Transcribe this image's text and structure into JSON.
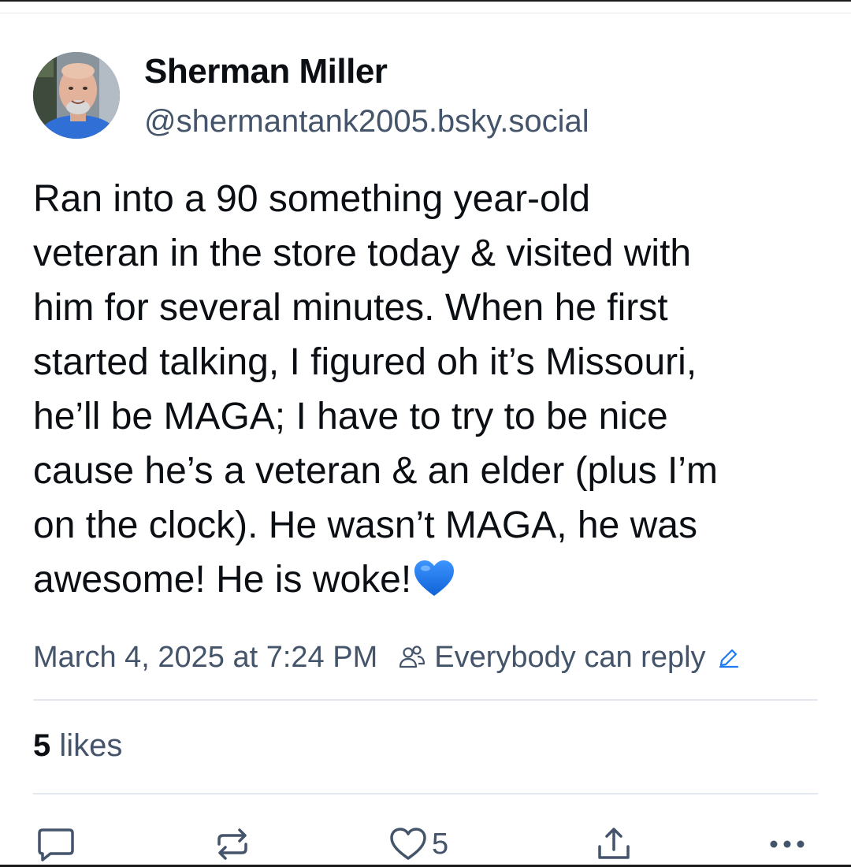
{
  "post": {
    "author": {
      "display_name": "Sherman Miller",
      "handle": "@shermantank2005.bsky.social",
      "avatar_icon": "profile-photo"
    },
    "text_lines": [
      "Ran into a 90 something year-old",
      "veteran in the store today & visited with",
      "him for several minutes. When he first",
      "started talking, I figured oh it’s Missouri,",
      "he’ll be MAGA; I have to try to be nice",
      "cause he’s a veteran & an elder (plus I’m",
      "on the clock). He wasn’t MAGA, he was",
      "awesome! He is woke!"
    ],
    "emoji": "blue-heart-emoji",
    "timestamp": "March 4, 2025 at 7:24 PM",
    "reply_setting": "Everybody can reply",
    "likes": {
      "count": "5",
      "label": "likes"
    },
    "actions": {
      "reply_icon": "reply-bubble-icon",
      "repost_icon": "repost-icon",
      "like_icon": "heart-icon",
      "like_count": "5",
      "share_icon": "share-icon",
      "more_icon": "more-dots-icon"
    }
  },
  "colors": {
    "text": "#0b0f14",
    "muted": "#44546a",
    "divider": "#e4e8ee",
    "emoji_blue": "#1d7bf0"
  }
}
